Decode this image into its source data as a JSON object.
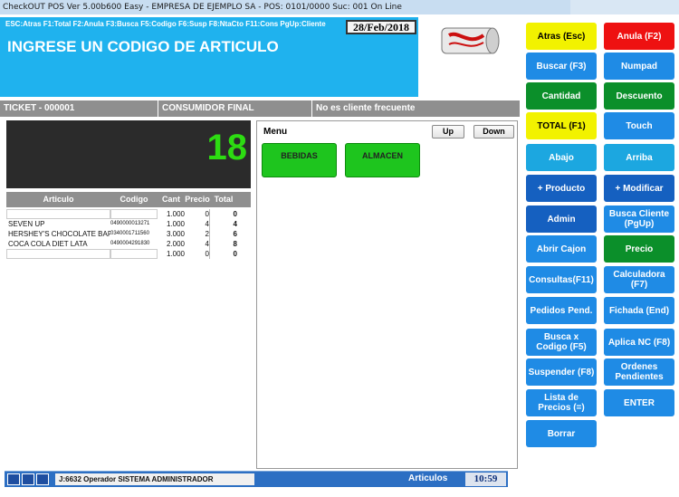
{
  "window": {
    "title": "CheckOUT POS Ver 5.00b600 Easy - EMPRESA DE EJEMPLO SA - POS: 0101/0000 Suc: 001  On Line"
  },
  "header": {
    "shortcuts": "ESC:Atras F1:Total F2:Anula F3:Busca F5:Codigo F6:Susp F8:NtaCto F11:Cons PgUp:Cliente",
    "date": "28/Feb/2018",
    "prompt": "INGRESE UN CODIGO DE ARTICULO"
  },
  "ticketbar": {
    "ticket": "TICKET - 000001",
    "customer": "CONSUMIDOR FINAL",
    "frequent": "No es cliente frecuente"
  },
  "display": {
    "value": "18"
  },
  "items": {
    "headers": [
      "Articulo",
      "Codigo",
      "Cant",
      "Precio",
      "Total"
    ],
    "rows": [
      {
        "articulo": "",
        "codigo": "",
        "cant": "1.000",
        "precio": "0",
        "total": "0"
      },
      {
        "articulo": "SEVEN UP",
        "codigo": "0490000013271",
        "cant": "1.000",
        "precio": "4",
        "total": "4"
      },
      {
        "articulo": "HERSHEY'S CHOCOLATE BAR",
        "codigo": "0340001711560",
        "cant": "3.000",
        "precio": "2",
        "total": "6"
      },
      {
        "articulo": "COCA COLA DIET LATA",
        "codigo": "0490004291830",
        "cant": "2.000",
        "precio": "4",
        "total": "8"
      },
      {
        "articulo": "",
        "codigo": "",
        "cant": "1.000",
        "precio": "0",
        "total": "0"
      }
    ]
  },
  "menu": {
    "title": "Menu",
    "up": "Up",
    "down": "Down",
    "categories": [
      "BEBIDAS",
      "ALMACEN"
    ]
  },
  "buttons": [
    {
      "label": "Atras (Esc)",
      "color": "#f2f200",
      "text": "#000000"
    },
    {
      "label": "Anula (F2)",
      "color": "#ee1111",
      "text": "#ffffff"
    },
    {
      "label": "Buscar (F3)",
      "color": "#1f8be5",
      "text": "#ffffff"
    },
    {
      "label": "Numpad",
      "color": "#1f8be5",
      "text": "#ffffff"
    },
    {
      "label": "Cantidad",
      "color": "#0b8f2a",
      "text": "#ffffff"
    },
    {
      "label": "Descuento",
      "color": "#0b8f2a",
      "text": "#ffffff"
    },
    {
      "label": "TOTAL (F1)",
      "color": "#f2f200",
      "text": "#000000"
    },
    {
      "label": "Touch",
      "color": "#1f8be5",
      "text": "#ffffff"
    },
    {
      "label": "Abajo",
      "color": "#1ca7e0",
      "text": "#ffffff"
    },
    {
      "label": "Arriba",
      "color": "#1ca7e0",
      "text": "#ffffff"
    },
    {
      "label": "+ Producto",
      "color": "#1560c0",
      "text": "#ffffff"
    },
    {
      "label": "+ Modificar",
      "color": "#1560c0",
      "text": "#ffffff"
    },
    {
      "label": "Admin",
      "color": "#1560c0",
      "text": "#ffffff"
    },
    {
      "label": "Busca Cliente (PgUp)",
      "color": "#1f8be5",
      "text": "#ffffff"
    },
    {
      "label": "Abrir Cajon",
      "color": "#1f8be5",
      "text": "#ffffff"
    },
    {
      "label": "Precio",
      "color": "#0b8f2a",
      "text": "#ffffff"
    },
    {
      "label": "Consultas(F11)",
      "color": "#1f8be5",
      "text": "#ffffff"
    },
    {
      "label": "Calculadora (F7)",
      "color": "#1f8be5",
      "text": "#ffffff"
    },
    {
      "label": "Pedidos Pend.",
      "color": "#1f8be5",
      "text": "#ffffff"
    },
    {
      "label": "Fichada (End)",
      "color": "#1f8be5",
      "text": "#ffffff"
    },
    {
      "label": "Busca x Codigo (F5)",
      "color": "#1f8be5",
      "text": "#ffffff"
    },
    {
      "label": "Aplica NC (F8)",
      "color": "#1f8be5",
      "text": "#ffffff"
    },
    {
      "label": "Suspender (F8)",
      "color": "#1f8be5",
      "text": "#ffffff"
    },
    {
      "label": "Ordenes Pendientes",
      "color": "#1f8be5",
      "text": "#ffffff"
    },
    {
      "label": "Lista de Precios (=)",
      "color": "#1f8be5",
      "text": "#ffffff"
    },
    {
      "label": "ENTER",
      "color": "#1f8be5",
      "text": "#ffffff"
    },
    {
      "label": "Borrar",
      "color": "#1f8be5",
      "text": "#ffffff"
    }
  ],
  "statusbar": {
    "operator": "J:6632 Operador  SISTEMA ADMINISTRADOR",
    "articulos": "Articulos",
    "time": "10:59"
  },
  "icons": [
    "app-icon",
    "printer-icon",
    "window-icon",
    "drink-can-icon",
    "user-icon"
  ]
}
